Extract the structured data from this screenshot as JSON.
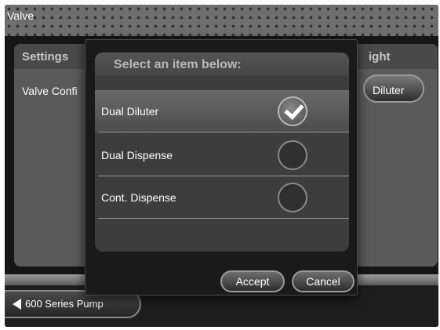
{
  "window": {
    "title": "Valve"
  },
  "background_panel": {
    "title": "Settings",
    "title_right_partial": "ight",
    "row_label_partial": "Valve Confi",
    "value_button_partial": "Diluter"
  },
  "dialog": {
    "header": "Select an item below:",
    "items": [
      {
        "label": "Dual Diluter",
        "selected": true
      },
      {
        "label": "Dual Dispense",
        "selected": false
      },
      {
        "label": "Cont. Dispense",
        "selected": false
      }
    ],
    "accept_label": "Accept",
    "cancel_label": "Cancel"
  },
  "footer": {
    "back_label": "600 Series Pump"
  },
  "icons": {
    "selected_indicator": "checkmark-icon",
    "back": "back-arrow-icon"
  }
}
